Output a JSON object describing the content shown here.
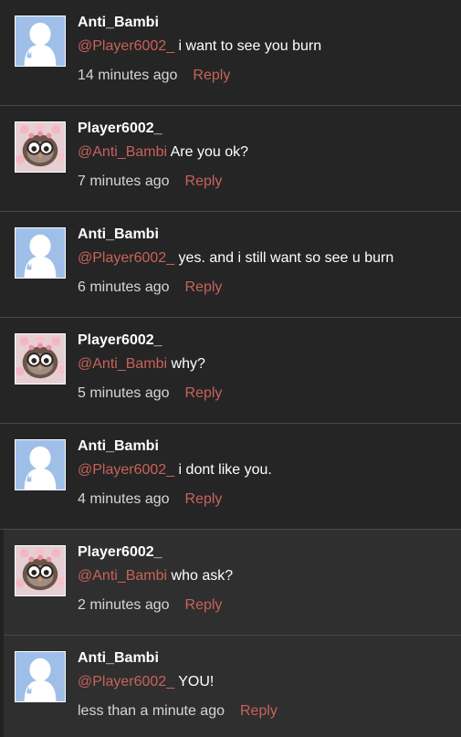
{
  "colors": {
    "background": "#222222",
    "highlight_background": "#2f2f2f",
    "divider": "#4a4a4a",
    "username": "#ffffff",
    "message_text": "#ffffff",
    "mention": "#c8625b",
    "timestamp": "#d6d6d6",
    "reply_link": "#c8625b"
  },
  "comments": [
    {
      "username": "Anti_Bambi",
      "avatar": "default-silhouette-avatar",
      "mention": "@Player6002_",
      "message": "i want to see you burn",
      "timestamp": "14 minutes ago",
      "reply_label": "Reply"
    },
    {
      "username": "Player6002_",
      "avatar": "owl-character-avatar",
      "mention": "@Anti_Bambi",
      "message": "Are you ok?",
      "timestamp": "7 minutes ago",
      "reply_label": "Reply"
    },
    {
      "username": "Anti_Bambi",
      "avatar": "default-silhouette-avatar",
      "mention": "@Player6002_",
      "message": "yes. and i still want so see u burn",
      "timestamp": "6 minutes ago",
      "reply_label": "Reply"
    },
    {
      "username": "Player6002_",
      "avatar": "owl-character-avatar",
      "mention": "@Anti_Bambi",
      "message": "why?",
      "timestamp": "5 minutes ago",
      "reply_label": "Reply"
    },
    {
      "username": "Anti_Bambi",
      "avatar": "default-silhouette-avatar",
      "mention": "@Player6002_",
      "message": "i dont like you.",
      "timestamp": "4 minutes ago",
      "reply_label": "Reply"
    },
    {
      "username": "Player6002_",
      "avatar": "owl-character-avatar",
      "mention": "@Anti_Bambi",
      "message": "who ask?",
      "timestamp": "2 minutes ago",
      "reply_label": "Reply"
    },
    {
      "username": "Anti_Bambi",
      "avatar": "default-silhouette-avatar",
      "mention": "@Player6002_",
      "message": "YOU!",
      "timestamp": "less than a minute ago",
      "reply_label": "Reply"
    }
  ]
}
